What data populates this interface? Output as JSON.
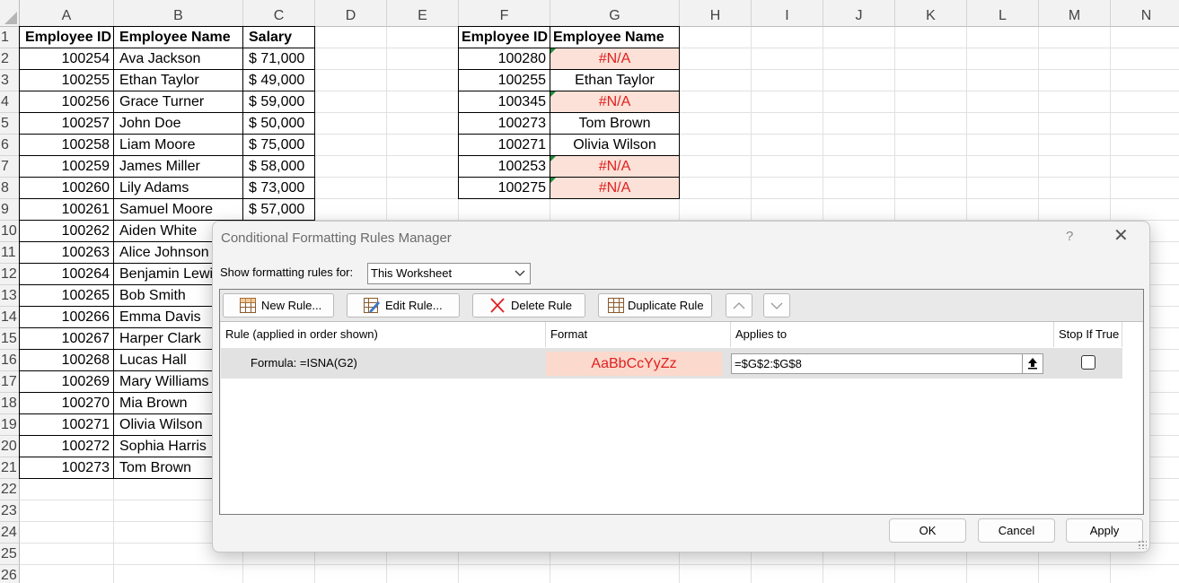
{
  "spreadsheet": {
    "columns": [
      "A",
      "B",
      "C",
      "D",
      "E",
      "F",
      "G",
      "H",
      "I",
      "J",
      "K",
      "L",
      "M",
      "N"
    ],
    "rows": [
      "1",
      "2",
      "3",
      "4",
      "5",
      "6",
      "7",
      "8",
      "9",
      "10",
      "11",
      "12",
      "13",
      "14",
      "15",
      "16",
      "17",
      "18",
      "19",
      "20",
      "21",
      "22",
      "23",
      "24",
      "25",
      "26"
    ],
    "table1": {
      "headers": [
        "Employee ID",
        "Employee Name",
        "Salary"
      ],
      "rows": [
        [
          "100254",
          "Ava Jackson",
          "$ 71,000"
        ],
        [
          "100255",
          "Ethan Taylor",
          "$ 49,000"
        ],
        [
          "100256",
          "Grace Turner",
          "$ 59,000"
        ],
        [
          "100257",
          "John Doe",
          "$ 50,000"
        ],
        [
          "100258",
          "Liam Moore",
          "$ 75,000"
        ],
        [
          "100259",
          "James Miller",
          "$ 58,000"
        ],
        [
          "100260",
          "Lily Adams",
          "$ 73,000"
        ],
        [
          "100261",
          "Samuel Moore",
          "$ 57,000"
        ],
        [
          "100262",
          "Aiden White",
          ""
        ],
        [
          "100263",
          "Alice Johnson",
          ""
        ],
        [
          "100264",
          "Benjamin Lewis",
          ""
        ],
        [
          "100265",
          "Bob Smith",
          ""
        ],
        [
          "100266",
          "Emma Davis",
          ""
        ],
        [
          "100267",
          "Harper Clark",
          ""
        ],
        [
          "100268",
          "Lucas Hall",
          ""
        ],
        [
          "100269",
          "Mary Williams",
          ""
        ],
        [
          "100270",
          "Mia Brown",
          ""
        ],
        [
          "100271",
          "Olivia Wilson",
          ""
        ],
        [
          "100272",
          "Sophia Harris",
          ""
        ],
        [
          "100273",
          "Tom Brown",
          ""
        ]
      ]
    },
    "table2": {
      "headers": [
        "Employee ID",
        "Employee Name"
      ],
      "rows": [
        {
          "id": "100280",
          "name": "#N/A",
          "error": true
        },
        {
          "id": "100255",
          "name": "Ethan Taylor",
          "error": false
        },
        {
          "id": "100345",
          "name": "#N/A",
          "error": true
        },
        {
          "id": "100273",
          "name": "Tom Brown",
          "error": false
        },
        {
          "id": "100271",
          "name": "Olivia Wilson",
          "error": false
        },
        {
          "id": "100253",
          "name": "#N/A",
          "error": true
        },
        {
          "id": "100275",
          "name": "#N/A",
          "error": true
        }
      ]
    },
    "colors": {
      "na_fill": "#fbe1d7",
      "na_text": "#e02020",
      "header_bg": "#f2f2f2",
      "gridline": "#e1e1e1"
    }
  },
  "dialog": {
    "title": "Conditional Formatting Rules Manager",
    "help": "?",
    "close": "✕",
    "show_label": "Show formatting rules for:",
    "scope_value": "This Worksheet",
    "toolbar": {
      "new_rule": "New Rule...",
      "edit_rule": "Edit Rule...",
      "delete_rule": "Delete Rule",
      "duplicate_rule": "Duplicate Rule",
      "move_up": "⌃",
      "move_down": "⌄"
    },
    "columns": {
      "rule": "Rule (applied in order shown)",
      "format": "Format",
      "applies_to": "Applies to",
      "stop_if_true": "Stop If True"
    },
    "rule": {
      "formula": "Formula: =ISNA(G2)",
      "format_preview": "AaBbCcYyZz",
      "applies_to": "=$G$2:$G$8",
      "stop_if_true": false
    },
    "buttons": {
      "ok": "OK",
      "cancel": "Cancel",
      "apply": "Apply"
    }
  }
}
